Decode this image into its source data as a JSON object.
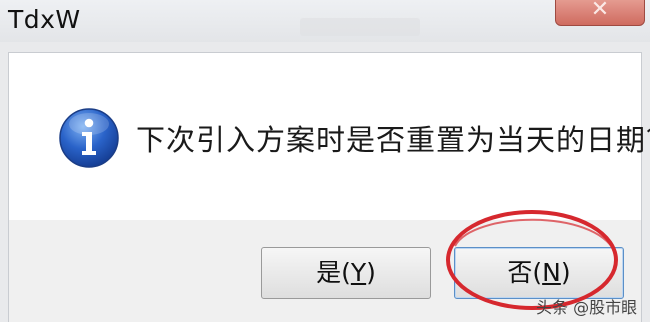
{
  "window": {
    "title": "TdxW",
    "close_symbol": "✕"
  },
  "dialog": {
    "icon": "information-icon",
    "message": "下次引入方案时是否重置为当天的日期？"
  },
  "buttons": {
    "yes": {
      "text": "是(",
      "hotkey": "Y",
      "tail": ")"
    },
    "no": {
      "text": "否(",
      "hotkey": "N",
      "tail": ")"
    }
  },
  "watermark": "头条 @股市眼",
  "colors": {
    "annotation_circle": "#d6282e",
    "icon_blue": "#1f4fb8",
    "close_button": "#cf6b5f"
  }
}
